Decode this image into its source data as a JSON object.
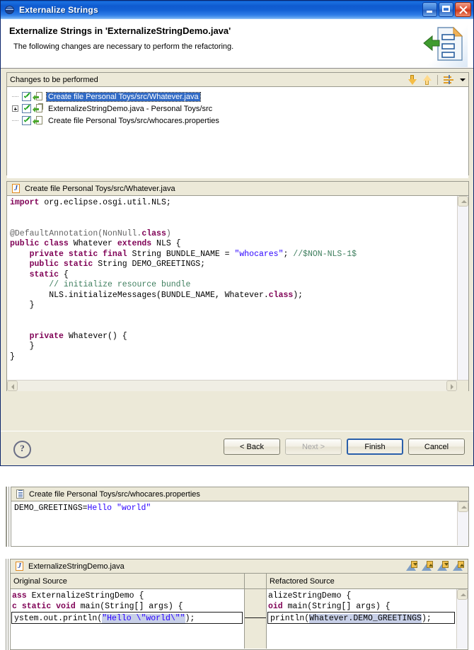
{
  "window": {
    "title": "Externalize Strings",
    "icon": "globe-icon",
    "minimize_label": "Minimize",
    "maximize_label": "Maximize",
    "close_label": "Close"
  },
  "header": {
    "title": "Externalize Strings in 'ExternalizeStringDemo.java'",
    "subtitle": "The following changes are necessary to perform the refactoring.",
    "art_icon": "refactor-document-icon"
  },
  "changes": {
    "section_title": "Changes to be performed",
    "toolbar": {
      "next_change": "down-arrow-icon",
      "previous_change": "up-arrow-icon",
      "view_menu": "expand-all-icon",
      "menu_caret": "chevron-down-icon"
    },
    "tree": [
      {
        "label": "Create file Personal Toys/src/Whatever.java",
        "checked": true,
        "selected": true,
        "expandable": false,
        "icon": "change-file-icon"
      },
      {
        "label": "ExternalizeStringDemo.java - Personal Toys/src",
        "checked": true,
        "selected": false,
        "expandable": true,
        "icon": "change-compilation-unit-icon"
      },
      {
        "label": "Create file Personal Toys/src/whocares.properties",
        "checked": true,
        "selected": false,
        "expandable": false,
        "icon": "change-file-icon"
      }
    ]
  },
  "java_preview": {
    "header_label": "Create file Personal Toys/src/Whatever.java",
    "header_icon": "java-file-icon",
    "lines": [
      [
        {
          "t": "import",
          "c": "kw"
        },
        {
          "t": " org.eclipse.osgi.util.NLS;",
          "c": ""
        }
      ],
      [],
      [],
      [
        {
          "t": "@DefaultAnnotation(NonNull.",
          "c": "ann"
        },
        {
          "t": "class",
          "c": "kw"
        },
        {
          "t": ")",
          "c": "ann"
        }
      ],
      [
        {
          "t": "public class",
          "c": "kw"
        },
        {
          "t": " Whatever ",
          "c": ""
        },
        {
          "t": "extends",
          "c": "kw"
        },
        {
          "t": " NLS {",
          "c": ""
        }
      ],
      [
        {
          "t": "    ",
          "c": ""
        },
        {
          "t": "private static final",
          "c": "kw"
        },
        {
          "t": " String BUNDLE_NAME = ",
          "c": ""
        },
        {
          "t": "\"whocares\"",
          "c": "str"
        },
        {
          "t": "; ",
          "c": ""
        },
        {
          "t": "//$NON-NLS-1$",
          "c": "cmt"
        }
      ],
      [
        {
          "t": "    ",
          "c": ""
        },
        {
          "t": "public static",
          "c": "kw"
        },
        {
          "t": " String DEMO_GREETINGS;",
          "c": ""
        }
      ],
      [
        {
          "t": "    ",
          "c": ""
        },
        {
          "t": "static",
          "c": "kw"
        },
        {
          "t": " {",
          "c": ""
        }
      ],
      [
        {
          "t": "        ",
          "c": ""
        },
        {
          "t": "// initialize resource bundle",
          "c": "cmt"
        }
      ],
      [
        {
          "t": "        NLS.initializeMessages(BUNDLE_NAME, Whatever.",
          "c": ""
        },
        {
          "t": "class",
          "c": "kw"
        },
        {
          "t": ");",
          "c": ""
        }
      ],
      [
        {
          "t": "    }",
          "c": ""
        }
      ],
      [],
      [],
      [
        {
          "t": "    ",
          "c": ""
        },
        {
          "t": "private",
          "c": "kw"
        },
        {
          "t": " Whatever() {",
          "c": ""
        }
      ],
      [
        {
          "t": "    }",
          "c": ""
        }
      ],
      [
        {
          "t": "}",
          "c": ""
        }
      ]
    ]
  },
  "buttons": {
    "help": "?",
    "back": "< Back",
    "next": "Next >",
    "finish": "Finish",
    "cancel": "Cancel"
  },
  "properties_preview": {
    "header_label": "Create file Personal Toys/src/whocares.properties",
    "header_icon": "properties-file-icon",
    "key": "DEMO_GREETINGS=",
    "value": "Hello \"world\""
  },
  "compare": {
    "header_label": "ExternalizeStringDemo.java",
    "header_icon": "java-file-icon",
    "toolbar": [
      "next-difference-icon",
      "previous-difference-icon",
      "next-change-icon",
      "previous-change-icon"
    ],
    "left_column_label": "Original Source",
    "right_column_label": "Refactored Source",
    "left_lines": [
      [
        {
          "t": "ass",
          "c": "kw"
        },
        {
          "t": " ExternalizeStringDemo {",
          "c": ""
        }
      ],
      [
        {
          "t": "c ",
          "c": "kw"
        },
        {
          "t": "static void",
          "c": "kw"
        },
        {
          "t": " main(String[] args) {",
          "c": ""
        }
      ]
    ],
    "left_diff": [
      {
        "t": "ystem.out.println(",
        "c": ""
      },
      {
        "t": "\"Hello \\\"world\\\"\"",
        "c": "str hl"
      },
      {
        "t": ");",
        "c": ""
      }
    ],
    "right_lines": [
      [
        {
          "t": "",
          "c": ""
        },
        {
          "t": "alizeStringDemo {",
          "c": ""
        }
      ],
      [
        {
          "t": "oid",
          "c": "kw"
        },
        {
          "t": " main(String[] args) {",
          "c": ""
        }
      ]
    ],
    "right_diff": [
      {
        "t": "println(",
        "c": ""
      },
      {
        "t": "Whatever.DEMO_GREETINGS",
        "c": "hl"
      },
      {
        "t": ");",
        "c": ""
      }
    ]
  }
}
